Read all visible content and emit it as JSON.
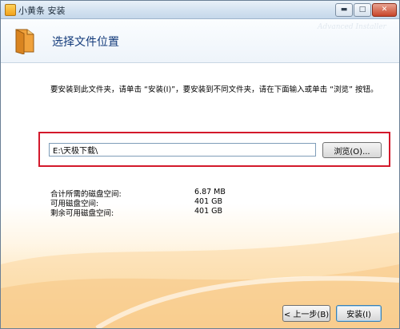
{
  "window": {
    "title": "小黄条 安装",
    "controls": {
      "minimize": "▬",
      "maximize": "□",
      "close": "✕"
    }
  },
  "header": {
    "title": "选择文件位置",
    "watermark": "Advanced Installer"
  },
  "instruction": "要安装到此文件夹，请单击 “安装(I)”，要安装到不同文件夹，请在下面输入或单击 “浏览” 按钮。",
  "install_path": {
    "value": "E:\\天极下载\\",
    "browse_label": "浏览(O)..."
  },
  "disk_space": [
    {
      "label": "合计所需的磁盘空间:",
      "value": "6.87 MB"
    },
    {
      "label": "可用磁盘空间:",
      "value": "401 GB"
    },
    {
      "label": "剩余可用磁盘空间:",
      "value": "401 GB"
    }
  ],
  "buttons": {
    "back": "< 上一步(B)",
    "install": "安装(I)"
  },
  "colors": {
    "highlight": "#d3192b",
    "header_title": "#123a7a"
  }
}
